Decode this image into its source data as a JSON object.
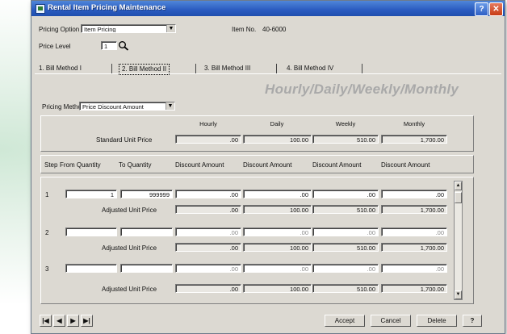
{
  "window": {
    "title": "Rental Item Pricing Maintenance",
    "help_glyph": "?",
    "close_glyph": "✕"
  },
  "header": {
    "pricing_option_label": "Pricing Option",
    "pricing_option_value": "Item Pricing",
    "item_no_label": "Item No.",
    "item_no_value": "40-6000",
    "price_level_label": "Price Level",
    "price_level_value": "1"
  },
  "tabs": [
    {
      "label": "1. Bill Method I"
    },
    {
      "label": "2. Bill Method II"
    },
    {
      "label": "3. Bill Method III"
    },
    {
      "label": "4. Bill Method IV"
    }
  ],
  "pricing": {
    "method_label": "Pricing Method",
    "method_value": "Price Discount Amount",
    "big_title": "Hourly/Daily/Weekly/Monthly"
  },
  "standard": {
    "row_label": "Standard Unit Price",
    "headers": [
      "Hourly",
      "Daily",
      "Weekly",
      "Monthly"
    ],
    "values": [
      ".00",
      "100.00",
      "510.00",
      "1,700.00"
    ]
  },
  "grid_headers": [
    "Step",
    "From Quantity",
    "To Quantity",
    "Discount Amount",
    "Discount Amount",
    "Discount Amount",
    "Discount Amount"
  ],
  "steps": [
    {
      "step": "1",
      "from": "1",
      "to": "999999",
      "discounts": [
        ".00",
        ".00",
        ".00",
        ".00"
      ],
      "adjusted_label": "Adjusted Unit Price",
      "adjusted": [
        ".00",
        "100.00",
        "510.00",
        "1,700.00"
      ]
    },
    {
      "step": "2",
      "from": "",
      "to": "",
      "discounts": [
        ".00",
        ".00",
        ".00",
        ".00"
      ],
      "adjusted_label": "Adjusted Unit Price",
      "adjusted": [
        ".00",
        "100.00",
        "510.00",
        "1,700.00"
      ]
    },
    {
      "step": "3",
      "from": "",
      "to": "",
      "discounts": [
        ".00",
        ".00",
        ".00",
        ".00"
      ],
      "adjusted_label": "Adjusted Unit Price",
      "adjusted": [
        ".00",
        "100.00",
        "510.00",
        "1,700.00"
      ]
    }
  ],
  "footer": {
    "nav": [
      "|◀",
      "◀",
      "▶",
      "▶|"
    ],
    "accept": "Accept",
    "cancel": "Cancel",
    "delete": "Delete",
    "help": "?"
  }
}
